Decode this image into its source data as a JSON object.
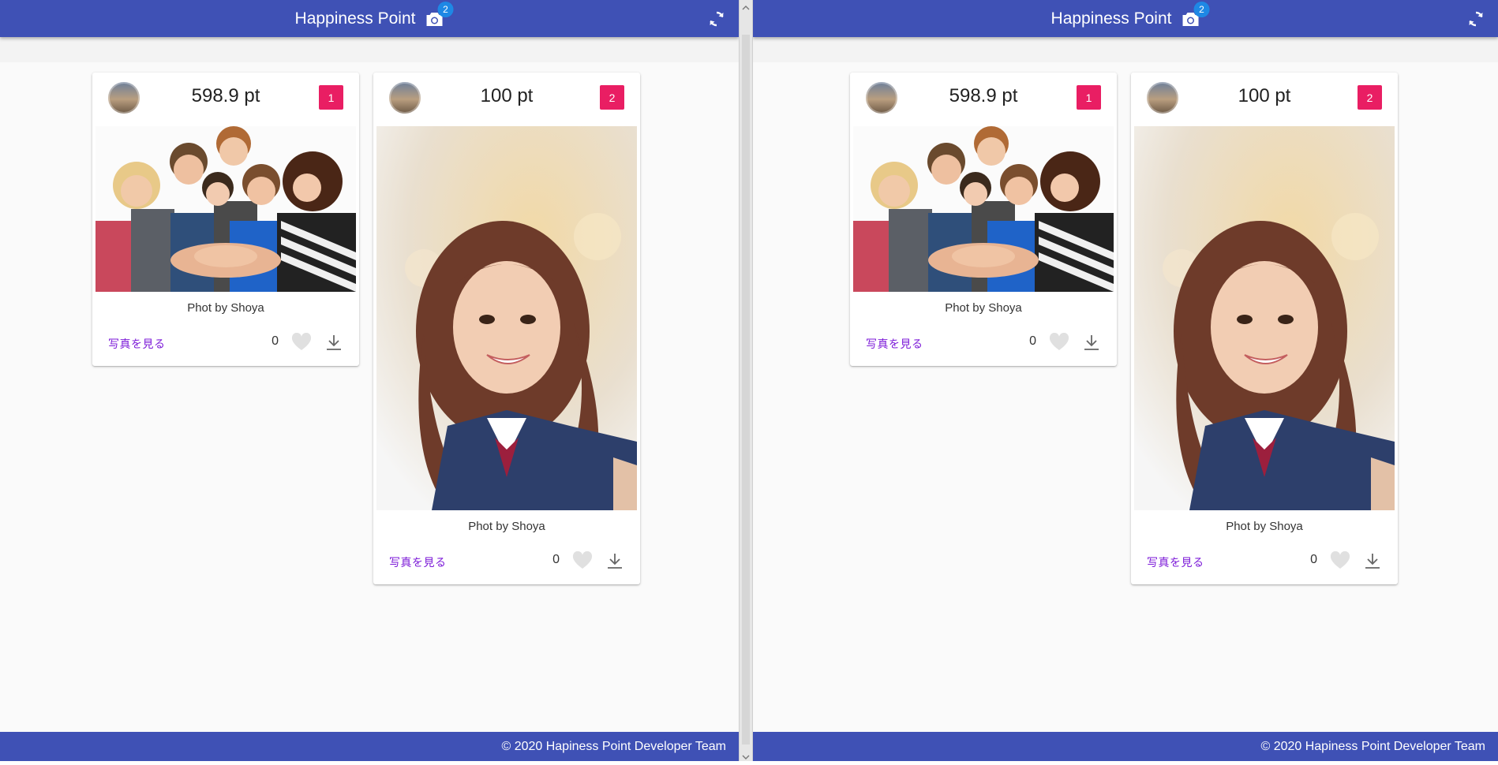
{
  "app": {
    "title": "Happiness Point",
    "camera_badge": "2",
    "footer_text": "© 2020 Hapiness Point Developer Team",
    "colors": {
      "appbar": "#3f51b5",
      "rank_badge": "#e91e63",
      "camera_badge": "#1e88e5",
      "link": "#7c1ad8"
    }
  },
  "icons": {
    "camera": "camera-icon",
    "refresh": "refresh-icon",
    "heart": "heart-icon",
    "download": "download-icon"
  },
  "cards": [
    {
      "points": "598.9 pt",
      "rank": "1",
      "caption": "Phot by Shoya",
      "view_label": "写真を見る",
      "likes": "0",
      "photo": "group of friends stacking hands"
    },
    {
      "points": "100 pt",
      "rank": "2",
      "caption": "Phot by Shoya",
      "view_label": "写真を見る",
      "likes": "0",
      "photo": "smiling girl in school uniform selfie"
    }
  ]
}
